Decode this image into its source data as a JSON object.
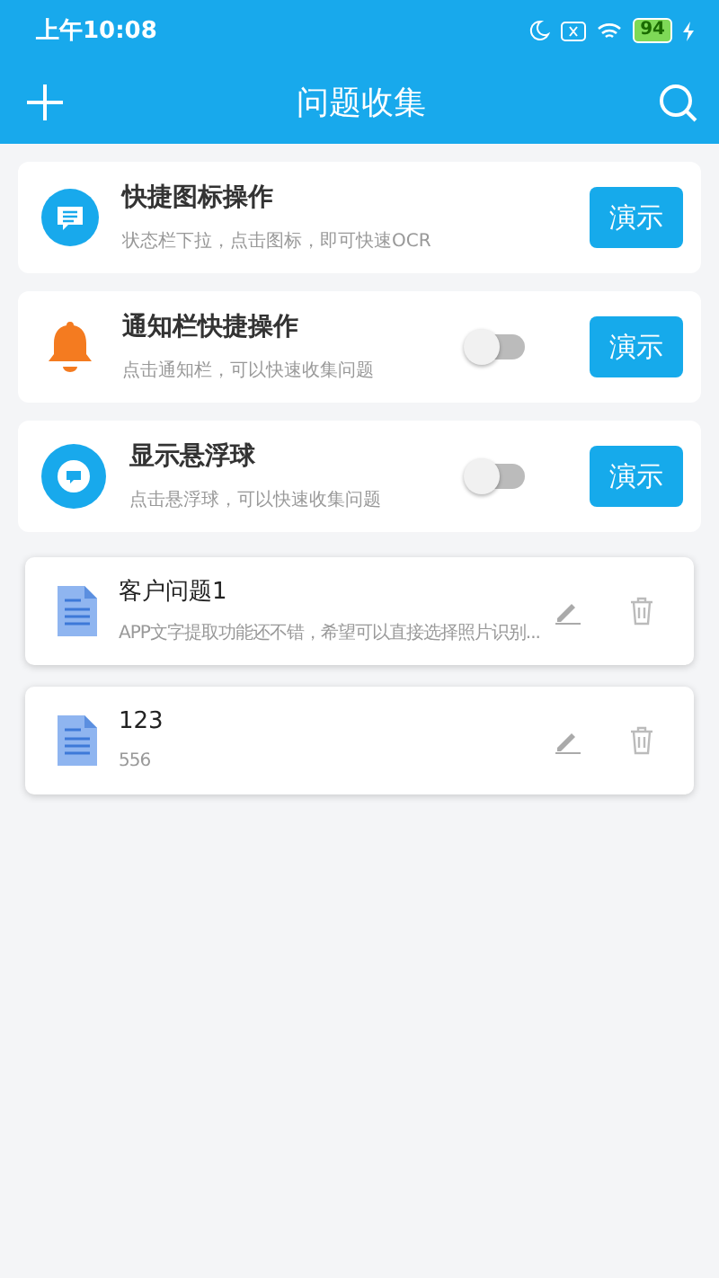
{
  "status_bar": {
    "time": "上午10:08",
    "battery": "94"
  },
  "app_bar": {
    "title": "问题收集"
  },
  "features": [
    {
      "kind": "shortcut",
      "title": "快捷图标操作",
      "description": "状态栏下拉，点击图标，即可快速OCR",
      "button": "演示"
    },
    {
      "kind": "notification",
      "title": "通知栏快捷操作",
      "description": "点击通知栏，可以快速收集问题",
      "on": false,
      "button": "演示"
    },
    {
      "kind": "float",
      "title": "显示悬浮球",
      "description": "点击悬浮球，可以快速收集问题",
      "on": false,
      "button": "演示"
    }
  ],
  "notes": [
    {
      "title": "客户问题1",
      "content": "APP文字提取功能还不错，希望可以直接选择照片识别..."
    },
    {
      "title": "123",
      "content": "556"
    }
  ]
}
